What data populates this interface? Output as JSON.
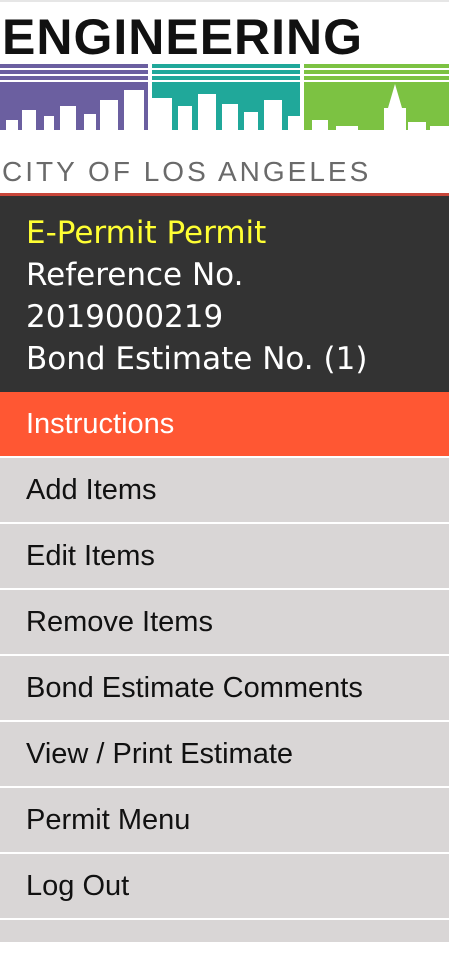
{
  "logo": {
    "word": "ENGINEERING",
    "city": "CITY OF LOS ANGELES",
    "colors": {
      "purple": "#6b5fa0",
      "teal": "#20a89a",
      "green": "#7cc242"
    }
  },
  "header": {
    "title": "E-Permit Permit",
    "reference_label": "Reference No.",
    "reference_number": "2019000219",
    "bond_estimate": "Bond Estimate No. (1)"
  },
  "menu": {
    "items": [
      {
        "label": "Instructions",
        "active": true
      },
      {
        "label": "Add Items",
        "active": false
      },
      {
        "label": "Edit Items",
        "active": false
      },
      {
        "label": "Remove Items",
        "active": false
      },
      {
        "label": "Bond Estimate Comments",
        "active": false
      },
      {
        "label": "View / Print Estimate",
        "active": false
      },
      {
        "label": "Permit Menu",
        "active": false
      },
      {
        "label": "Log Out",
        "active": false
      }
    ]
  },
  "colors": {
    "header_bg": "#333333",
    "header_title": "#ffff33",
    "active_item": "#ff5733",
    "menu_bg": "#d9d6d6"
  }
}
